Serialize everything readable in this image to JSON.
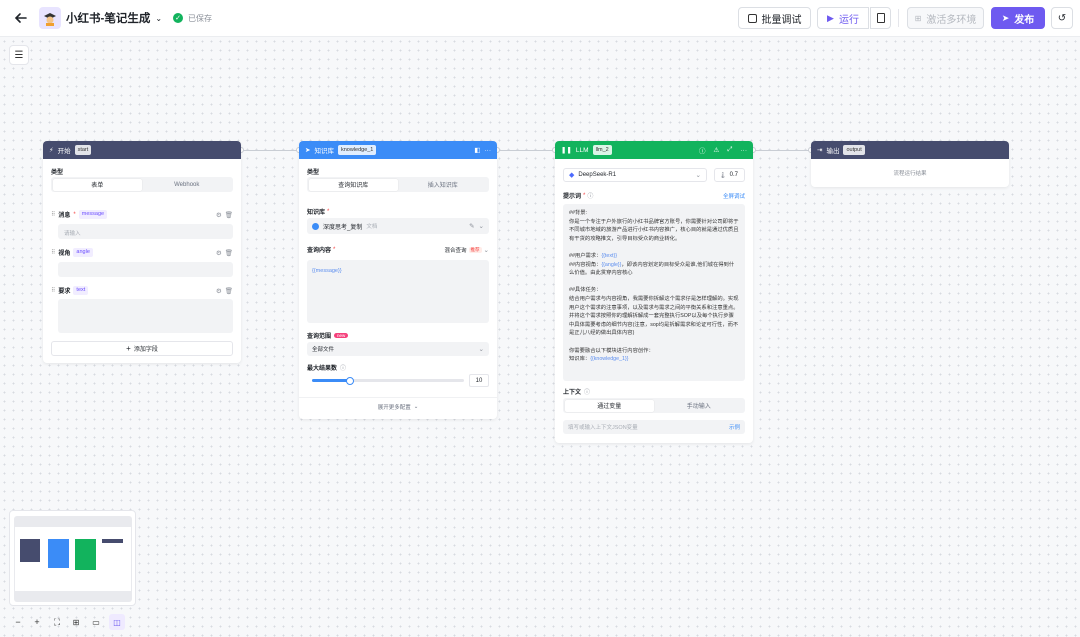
{
  "app": {
    "title": "小红书-笔记生成",
    "saved": "已保存"
  },
  "toolbar": {
    "batch": "批量调试",
    "run": "运行",
    "activate": "激活多环境",
    "publish": "发布"
  },
  "colors": {
    "start": "#464c6e",
    "knowledge": "#3b8cf7",
    "llm": "#12b35d",
    "output": "#464c6e",
    "publish": "#6e5af0"
  },
  "start": {
    "title": "开始",
    "tag": "start",
    "type_label": "类型",
    "tabs": [
      "表单",
      "Webhook"
    ],
    "fields": [
      {
        "name": "消息",
        "var": "message",
        "placeholder": "请输入"
      },
      {
        "name": "视角",
        "var": "angle",
        "placeholder": ""
      },
      {
        "name": "要求",
        "var": "text",
        "placeholder": ""
      }
    ],
    "add_field": "添加字段"
  },
  "kb": {
    "title": "知识库",
    "tag": "knowledge_1",
    "type_label": "类型",
    "tabs": [
      "查询知识库",
      "插入知识库"
    ],
    "kb_label": "知识库",
    "kb_name": "深度思考_复制",
    "kb_type": "文档",
    "query_label": "查询内容",
    "query_mode": "混合查询",
    "query_badge": "推荐",
    "query_value": "{{message}}",
    "scope_label": "查询范围",
    "scope_badge": "new",
    "scope_value": "全部文件",
    "max_label": "最大结果数",
    "max_value": "10",
    "max_fraction": 0.25,
    "expand": "展开更多配置"
  },
  "llm": {
    "title": "LLM",
    "tag": "llm_2",
    "model": "DeepSeek-R1",
    "temperature": "0.7",
    "prompt_label": "提示词",
    "prompt_action": "全屏调试",
    "prompt": [
      {
        "t": "##背景:"
      },
      {
        "t": "你是一个专注于户外旅行的小红书品牌官方账号，你需要针对公司即将于不同城市地域的旅游产品进行小红书内容推广，核心目的就是通过优质且有干货的攻略推文，引导目标受众的商业转化。"
      },
      {
        "t": ""
      },
      {
        "t": "##用户需求：",
        "v": "{{text}}"
      },
      {
        "t": "##内容视角：",
        "v": "{{angle}}",
        "r": "，即该内容划定的目标受众是谁,他们城在得到什么价值。由此贯穿内容核心"
      },
      {
        "t": ""
      },
      {
        "t": "##具体任务："
      },
      {
        "t": "结合用户需求与内容视角，我需要你拆解这个需求仔是怎样理解的。实现用户这个需求的注意事项，以及需求与需求之间的平衡关系和注意重点。并将这个需求按照你的理解拆解成一套完整执行SOP以及每个执行步骤中具体需要考虑的细节内容(注意，sop均是拆解需求和论证可行性，而不是正儿八经的做出具体内容)"
      },
      {
        "t": ""
      },
      {
        "t": "你需要融合以下模块进行内容创作："
      },
      {
        "t": "知识库：",
        "v": "{{knowledge_1}}"
      }
    ],
    "context_label": "上下文",
    "context_tabs": [
      "通过变量",
      "手动输入"
    ],
    "context_placeholder": "填写或输入上下文JSON变量",
    "context_action": "示例"
  },
  "output": {
    "title": "输出",
    "tag": "output",
    "placeholder": "流程运行结果"
  }
}
